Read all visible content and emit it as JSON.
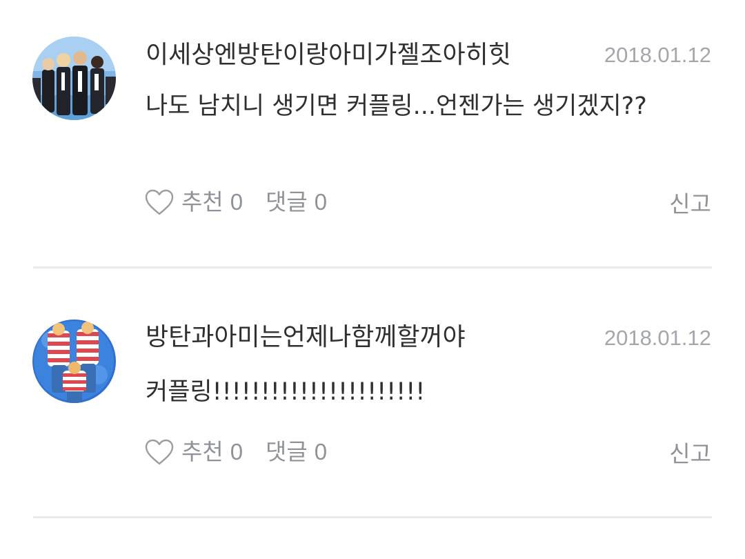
{
  "comments": [
    {
      "username": "이세상엔방탄이랑아미가젤조아히힛",
      "date": "2018.01.12",
      "text": "나도 남치니 생기면 커플링...언젠가는 생기겠지??",
      "like_label": "추천",
      "like_count": "0",
      "reply_label": "댓글",
      "reply_count": "0",
      "report_label": "신고"
    },
    {
      "username": "방탄과아미는언제나함께할꺼야",
      "date": "2018.01.12",
      "text": "커플링!!!!!!!!!!!!!!!!!!!!!!",
      "like_label": "추천",
      "like_count": "0",
      "reply_label": "댓글",
      "reply_count": "0",
      "report_label": "신고"
    }
  ],
  "icons": {
    "like": "heart-outline-icon"
  },
  "colors": {
    "text": "#2f2f2f",
    "muted": "#8f9399",
    "date": "#a3a6ab",
    "divider": "#e8eaed"
  }
}
